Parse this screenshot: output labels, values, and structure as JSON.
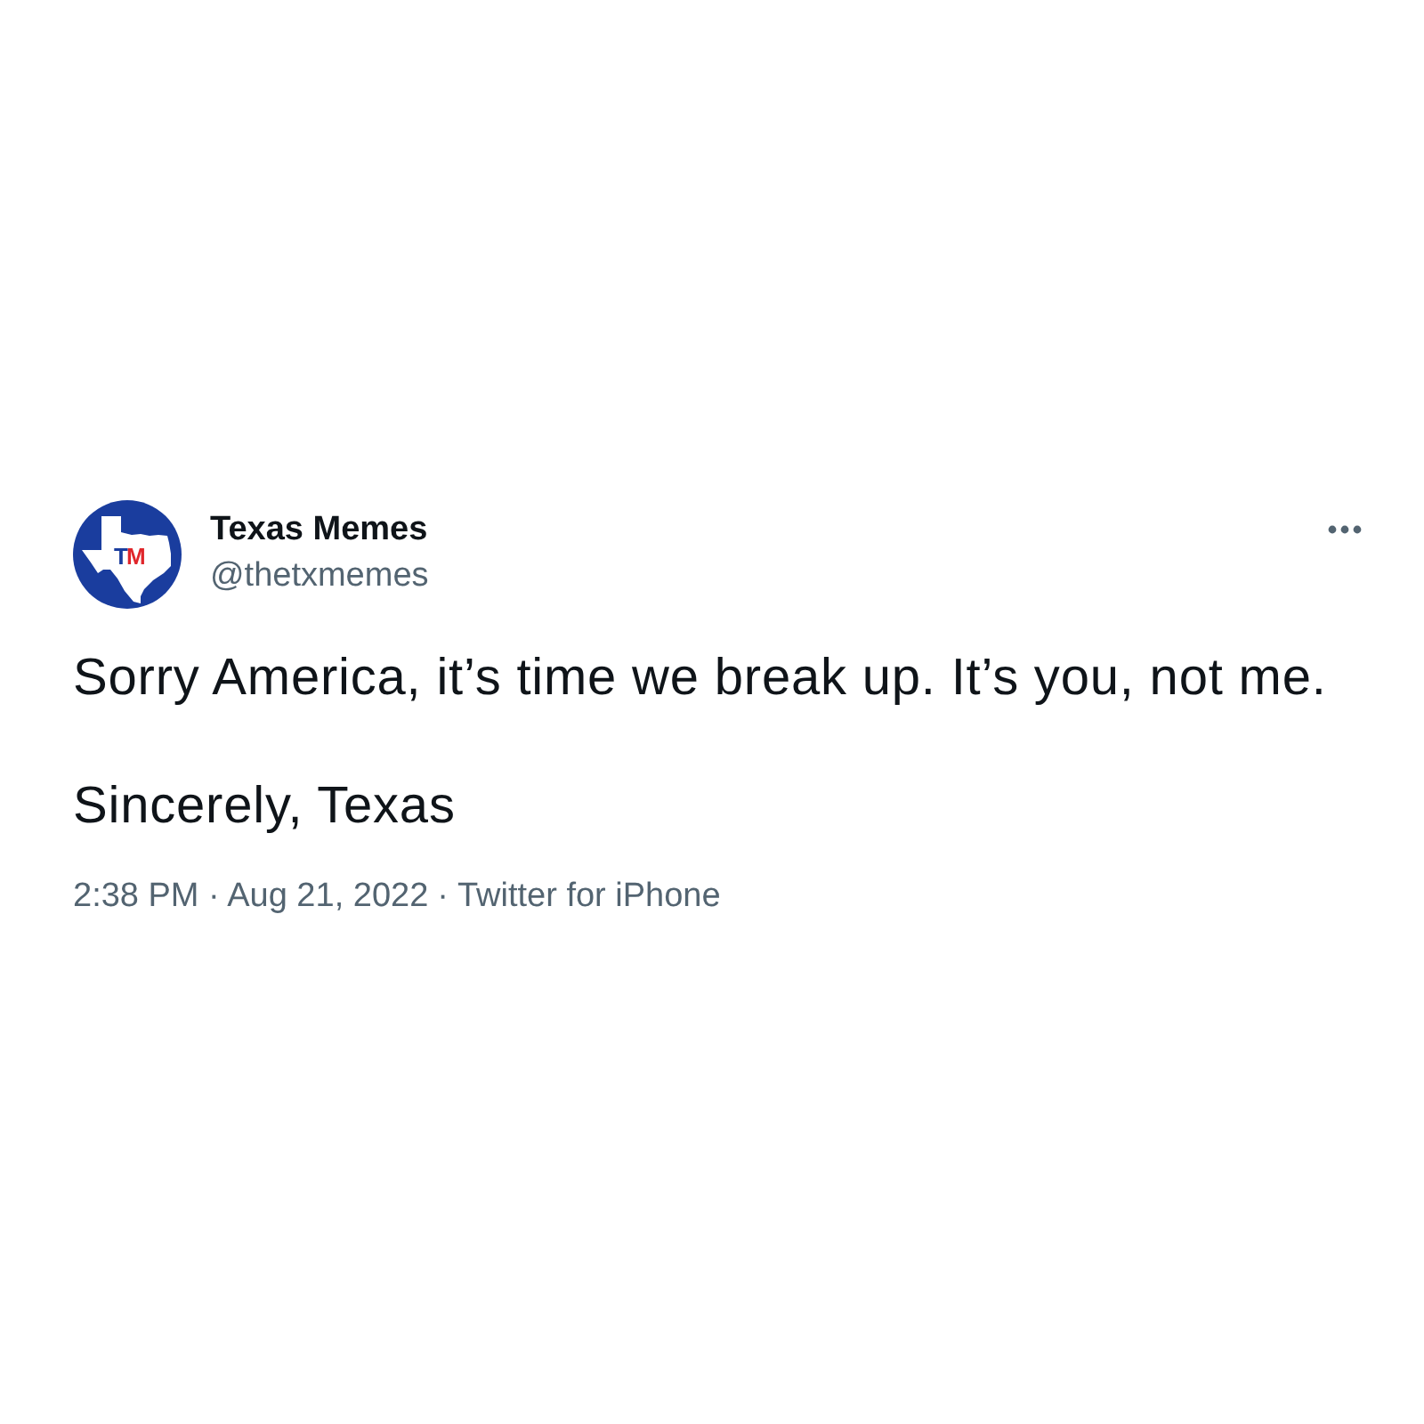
{
  "tweet": {
    "author": {
      "name": "Texas Memes",
      "handle": "@thetxmemes",
      "logo_letters": [
        {
          "text": "T",
          "color": "#1a3d9e"
        },
        {
          "text": "M",
          "color": "#e0262b"
        }
      ]
    },
    "paragraphs": [
      "Sorry America, it’s time we break up. It’s you, not me.",
      "Sincerely, Texas"
    ],
    "meta": {
      "timestamp": "2:38 PM · Aug 21, 2022",
      "separator": "·",
      "source": "Twitter for iPhone"
    }
  }
}
